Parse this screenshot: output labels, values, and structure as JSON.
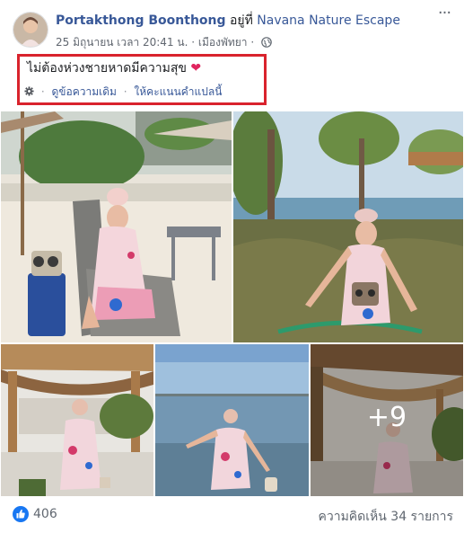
{
  "post": {
    "author": "Portakthong Boonthong",
    "at_text": " อยู่ที่ ",
    "place": "Navana Nature Escape",
    "date": "25 มิถุนายน เวลา 20:41 น.",
    "dot": " · ",
    "location": "เมืองพัทยา",
    "dot2": " · ",
    "more_label": "···",
    "text": "ไม่ต้องห่วงชายหาดมีความสุข",
    "heart": "❤",
    "see_original": "ดูข้อความเดิม",
    "sep": "·",
    "rate_translation": "ให้คะแนนคำแปลนี้",
    "privacy_icon": "globe-icon",
    "settings_icon": "gear-icon"
  },
  "photos": {
    "more_count": "+9"
  },
  "footer": {
    "likes": "406",
    "comments": "ความคิดเห็น 34 รายการ"
  },
  "colors": {
    "link": "#385898",
    "highlight": "#d9232d",
    "like_blue": "#1877f2"
  }
}
